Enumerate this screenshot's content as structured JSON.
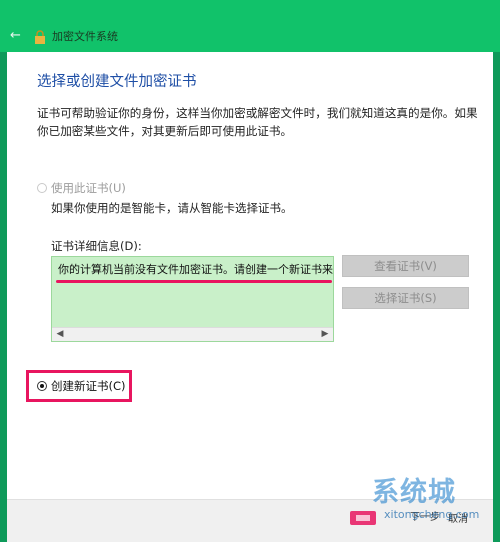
{
  "window": {
    "title": "加密文件系统"
  },
  "dialog": {
    "heading": "选择或创建文件加密证书",
    "description": "证书可帮助验证你的身份，这样当你加密或解密文件时，我们就知道这真的是你。如果你已加密某些文件，对其更新后即可使用此证书。",
    "use_cert_label": "使用此证书(U)",
    "smartcard_note": "如果你使用的是智能卡，请从智能卡选择证书。",
    "details_label": "证书详细信息(D):",
    "details_text": "你的计算机当前没有文件加密证书。请创建一个新证书来加密文件。",
    "view_cert_button": "查看证书(V)",
    "select_cert_button": "选择证书(S)",
    "create_cert_label": "创建新证书(C)",
    "footer_button_1": "下一步",
    "footer_button_2": "取消"
  },
  "watermark": {
    "text": "系统城",
    "url": "xitongcheng.com"
  },
  "colors": {
    "titlebar": "#11c26a",
    "details_bg": "#c9f0c9",
    "highlight": "#e8155f",
    "heading": "#1f4fa6"
  }
}
